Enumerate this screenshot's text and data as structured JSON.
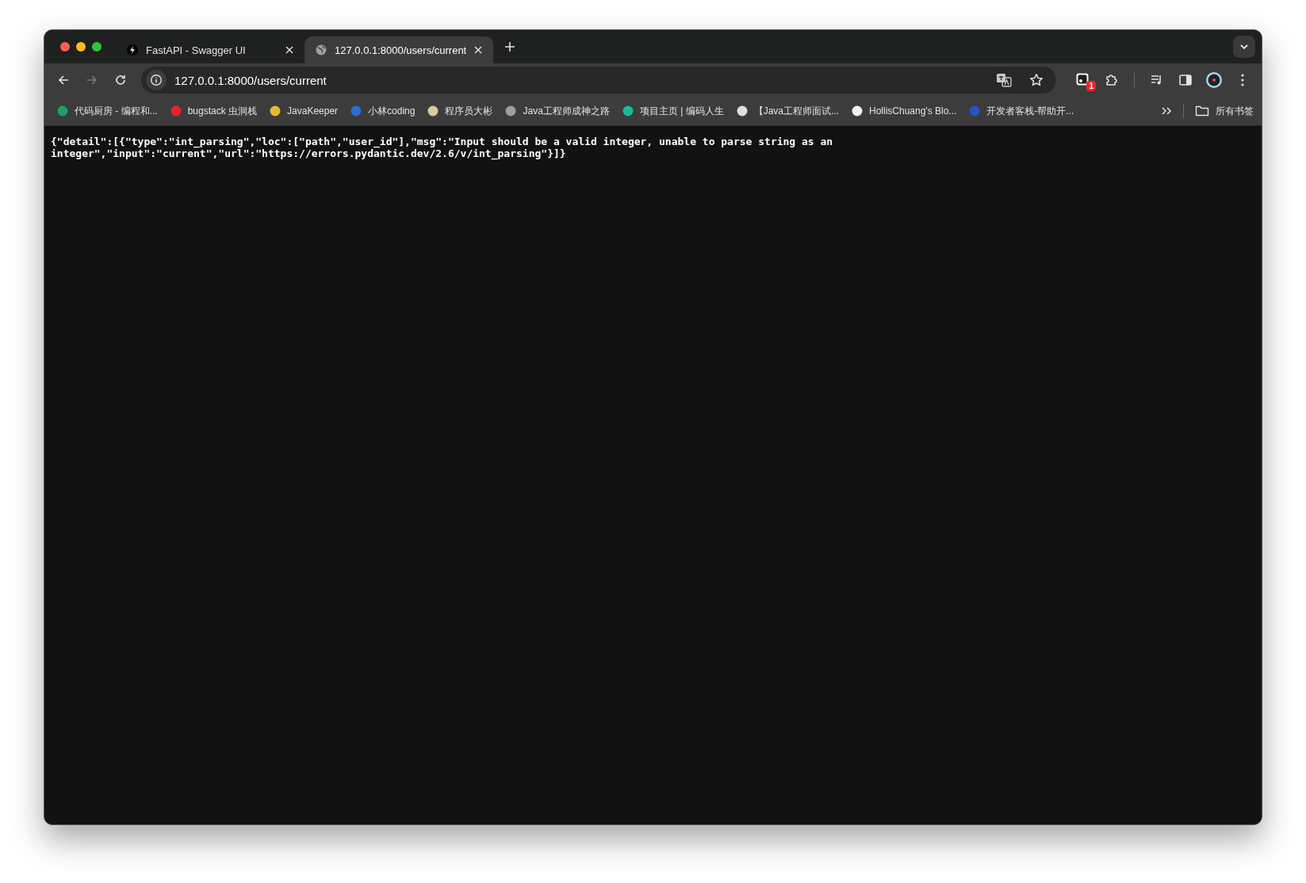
{
  "tabs": [
    {
      "title": "FastAPI - Swagger UI",
      "selected": false
    },
    {
      "title": "127.0.0.1:8000/users/current",
      "selected": true
    }
  ],
  "address_bar": {
    "url": "127.0.0.1:8000/users/current"
  },
  "navigation": {
    "back_disabled": false,
    "forward_disabled": true
  },
  "extension_badge": "1",
  "bookmarks": [
    {
      "title": "代码厨房 - 编程和...",
      "color": "#1aa260"
    },
    {
      "title": "bugstack 虫洞栈",
      "color": "#e8242b"
    },
    {
      "title": "JavaKeeper",
      "color": "#e8b830"
    },
    {
      "title": "小林coding",
      "color": "#2a6fc9"
    },
    {
      "title": "程序员大彬",
      "color": "#d9c9a0"
    },
    {
      "title": "Java工程师成神之路",
      "color": "#9aa0a6"
    },
    {
      "title": "项目主页 | 编码人生",
      "color": "#1fb89a"
    },
    {
      "title": "【Java工程师面试...",
      "color": "#e0e0e0"
    },
    {
      "title": "HollisChuang's Blo...",
      "color": "#f0f0f0"
    },
    {
      "title": "开发者客栈-帮助开...",
      "color": "#2454c6"
    }
  ],
  "all_bookmarks": "所有书签",
  "page_text": "{\"detail\":[{\"type\":\"int_parsing\",\"loc\":[\"path\",\"user_id\"],\"msg\":\"Input should be a valid integer, unable to parse string as an integer\",\"input\":\"current\",\"url\":\"https://errors.pydantic.dev/2.6/v/int_parsing\"}]}"
}
